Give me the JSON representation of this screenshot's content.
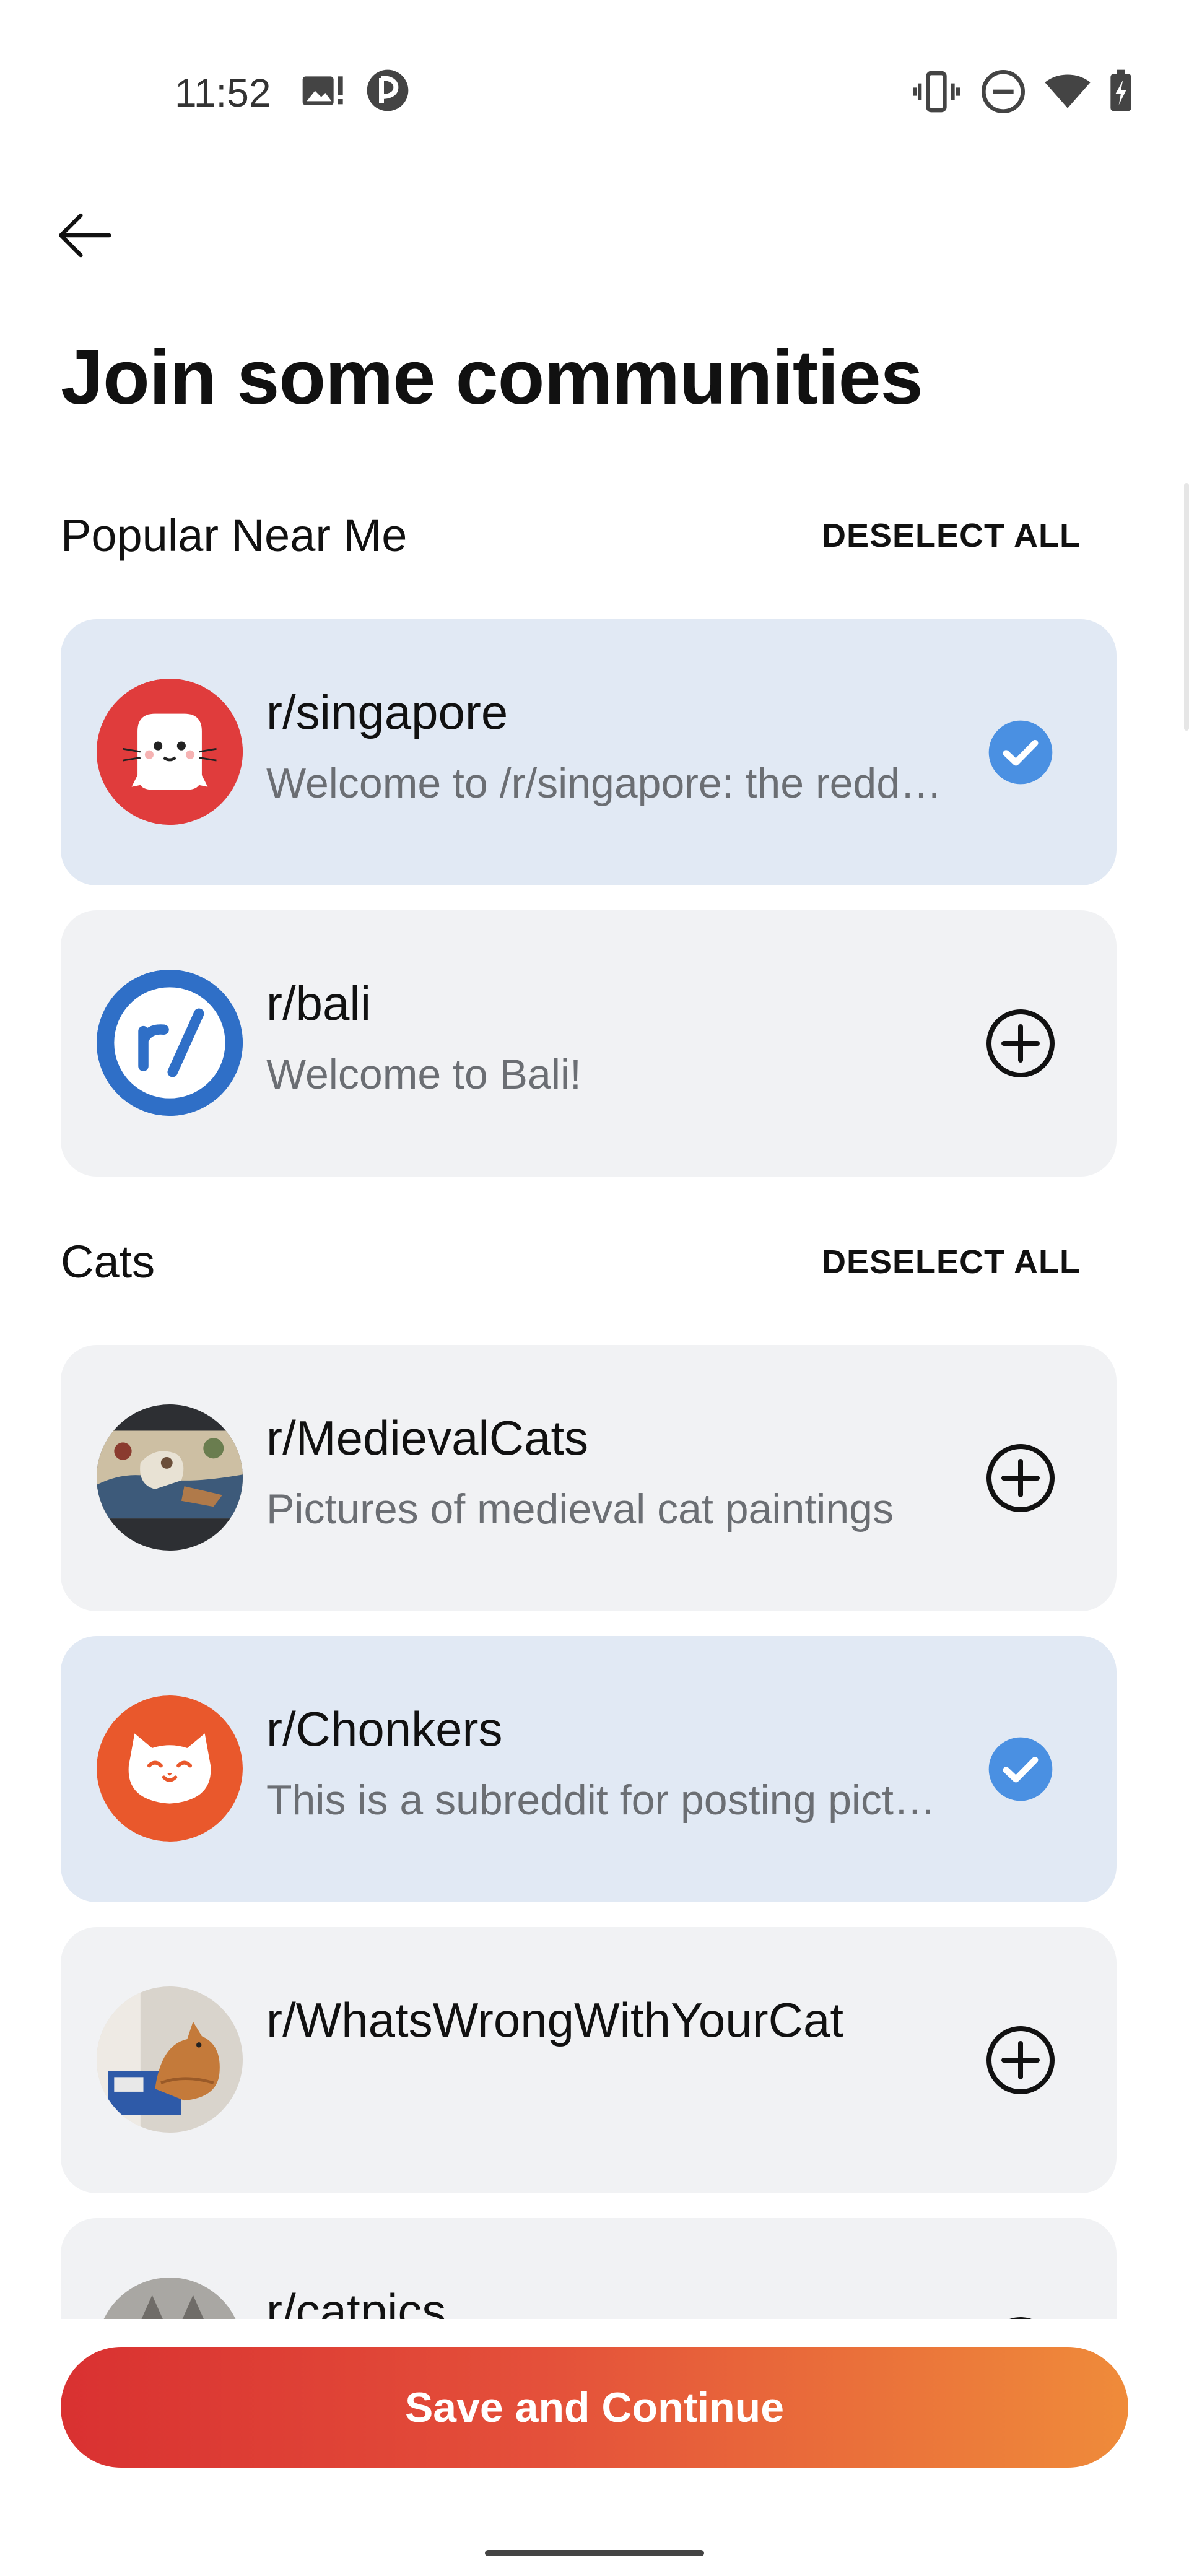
{
  "status_bar": {
    "time": "11:52",
    "left_icons": [
      "image-notification-icon",
      "app-notification-icon"
    ],
    "right_icons": [
      "vibrate-icon",
      "do-not-disturb-icon",
      "wifi-icon",
      "battery-charging-icon"
    ]
  },
  "header": {
    "back_icon": "arrow-left-icon",
    "title": "Join some communities"
  },
  "sections": [
    {
      "title": "Popular Near Me",
      "deselect_label": "DESELECT ALL",
      "communities": [
        {
          "name": "r/singapore",
          "description": "Welcome to /r/singapore: the reddit community for Singapore",
          "selected": true
        },
        {
          "name": "r/bali",
          "description": "Welcome to Bali!",
          "selected": false
        }
      ]
    },
    {
      "title": "Cats",
      "deselect_label": "DESELECT ALL",
      "communities": [
        {
          "name": "r/MedievalCats",
          "description": "Pictures of medieval cat paintings",
          "selected": false
        },
        {
          "name": "r/Chonkers",
          "description": "This is a subreddit for posting pictures of chonky cats",
          "selected": true
        },
        {
          "name": "r/WhatsWrongWithYourCat",
          "description": "",
          "selected": false
        },
        {
          "name": "r/catpics",
          "description": "",
          "selected": false
        }
      ]
    }
  ],
  "footer": {
    "cta_label": "Save and Continue"
  },
  "colors": {
    "selected_card": "#e1e9f4",
    "unselected_card": "#f1f2f4",
    "check_blue": "#4a90e2",
    "cta_start": "#d93131",
    "cta_end": "#ef8b3a"
  }
}
